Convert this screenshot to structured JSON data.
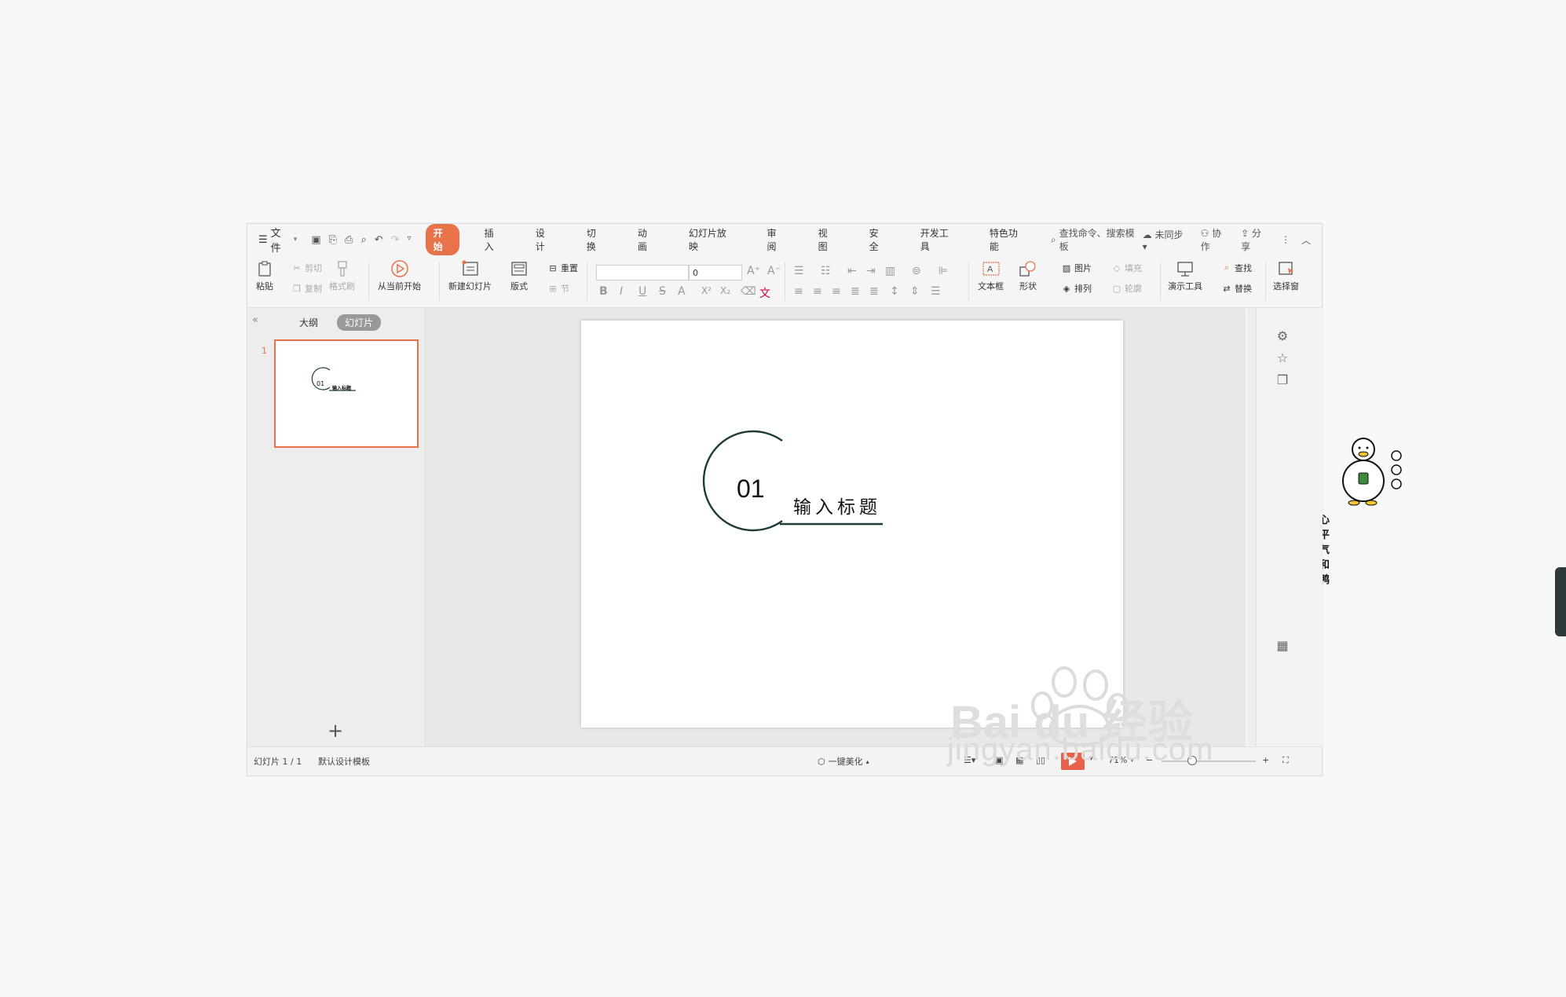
{
  "menu": {
    "file": "文件",
    "tabs": [
      "开始",
      "插入",
      "设计",
      "切换",
      "动画",
      "幻灯片放映",
      "审阅",
      "视图",
      "安全",
      "开发工具",
      "特色功能"
    ],
    "active_tab": "开始",
    "search": "查找命令、搜索模板",
    "sync": "未同步",
    "collab": "协作",
    "share": "分享"
  },
  "ribbon": {
    "paste": "粘贴",
    "cut": "剪切",
    "copy": "复制",
    "format_painter": "格式刷",
    "from_current": "从当前开始",
    "new_slide": "新建幻灯片",
    "layout": "版式",
    "reset": "重置",
    "section": "节",
    "font_size": "0",
    "textbox": "文本框",
    "shape": "形状",
    "picture": "图片",
    "fill": "填充",
    "arrange": "排列",
    "outline": "轮廓",
    "present_tools": "演示工具",
    "find": "查找",
    "replace": "替换",
    "select_pane": "选择窗"
  },
  "panel": {
    "outline_tab": "大纲",
    "slides_tab": "幻灯片",
    "slide_number": "1",
    "thumb_num": "01",
    "thumb_title": "输入标题"
  },
  "slide": {
    "number": "01",
    "title": "输入标题",
    "accent_color": "#1e3b3b"
  },
  "logo": {
    "caption": "心平气和鸭"
  },
  "status": {
    "slide_info": "幻灯片 1 / 1",
    "template": "默认设计模板",
    "beautify": "一键美化",
    "zoom": "71%"
  },
  "watermark": {
    "text": "jingyan.baidu.com",
    "brand": "Bai du 经验"
  }
}
